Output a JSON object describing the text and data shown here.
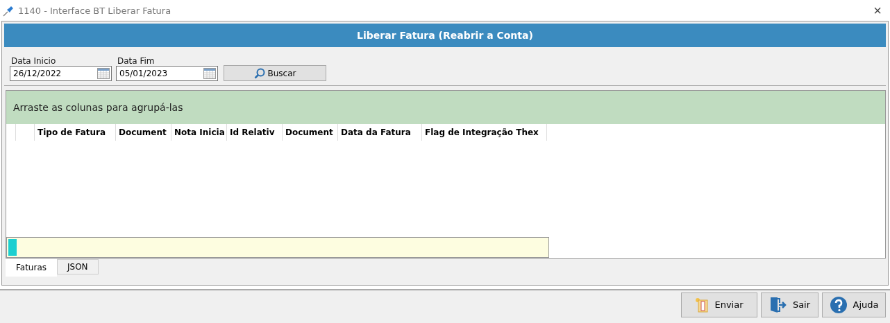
{
  "window": {
    "title": "1140 - Interface BT Liberar Fatura",
    "close": "×"
  },
  "header": {
    "title": "Liberar Fatura (Reabrir a Conta)"
  },
  "filters": [
    {
      "label": "Data Inicio",
      "value": "26/12/2022"
    },
    {
      "label": "Data Fim",
      "value": "05/01/2023"
    }
  ],
  "search_button": {
    "label": "Buscar"
  },
  "grid": {
    "group_hint": "Arraste as colunas para agrupá-las",
    "columns": [
      {
        "label": "Tipo de Fatura"
      },
      {
        "label": "Document"
      },
      {
        "label": "Nota Inicia"
      },
      {
        "label": "Id Relativ"
      },
      {
        "label": "Document"
      },
      {
        "label": "Data da Fatura"
      },
      {
        "label": "Flag de Integração Thex"
      }
    ]
  },
  "tabs": [
    {
      "label": "Faturas",
      "selected": true
    },
    {
      "label": "JSON",
      "selected": false
    }
  ],
  "buttons": [
    {
      "label": "Enviar",
      "kind": "send"
    },
    {
      "label": "Sair",
      "kind": "exit"
    },
    {
      "label": "Ajuda",
      "kind": "help"
    }
  ]
}
